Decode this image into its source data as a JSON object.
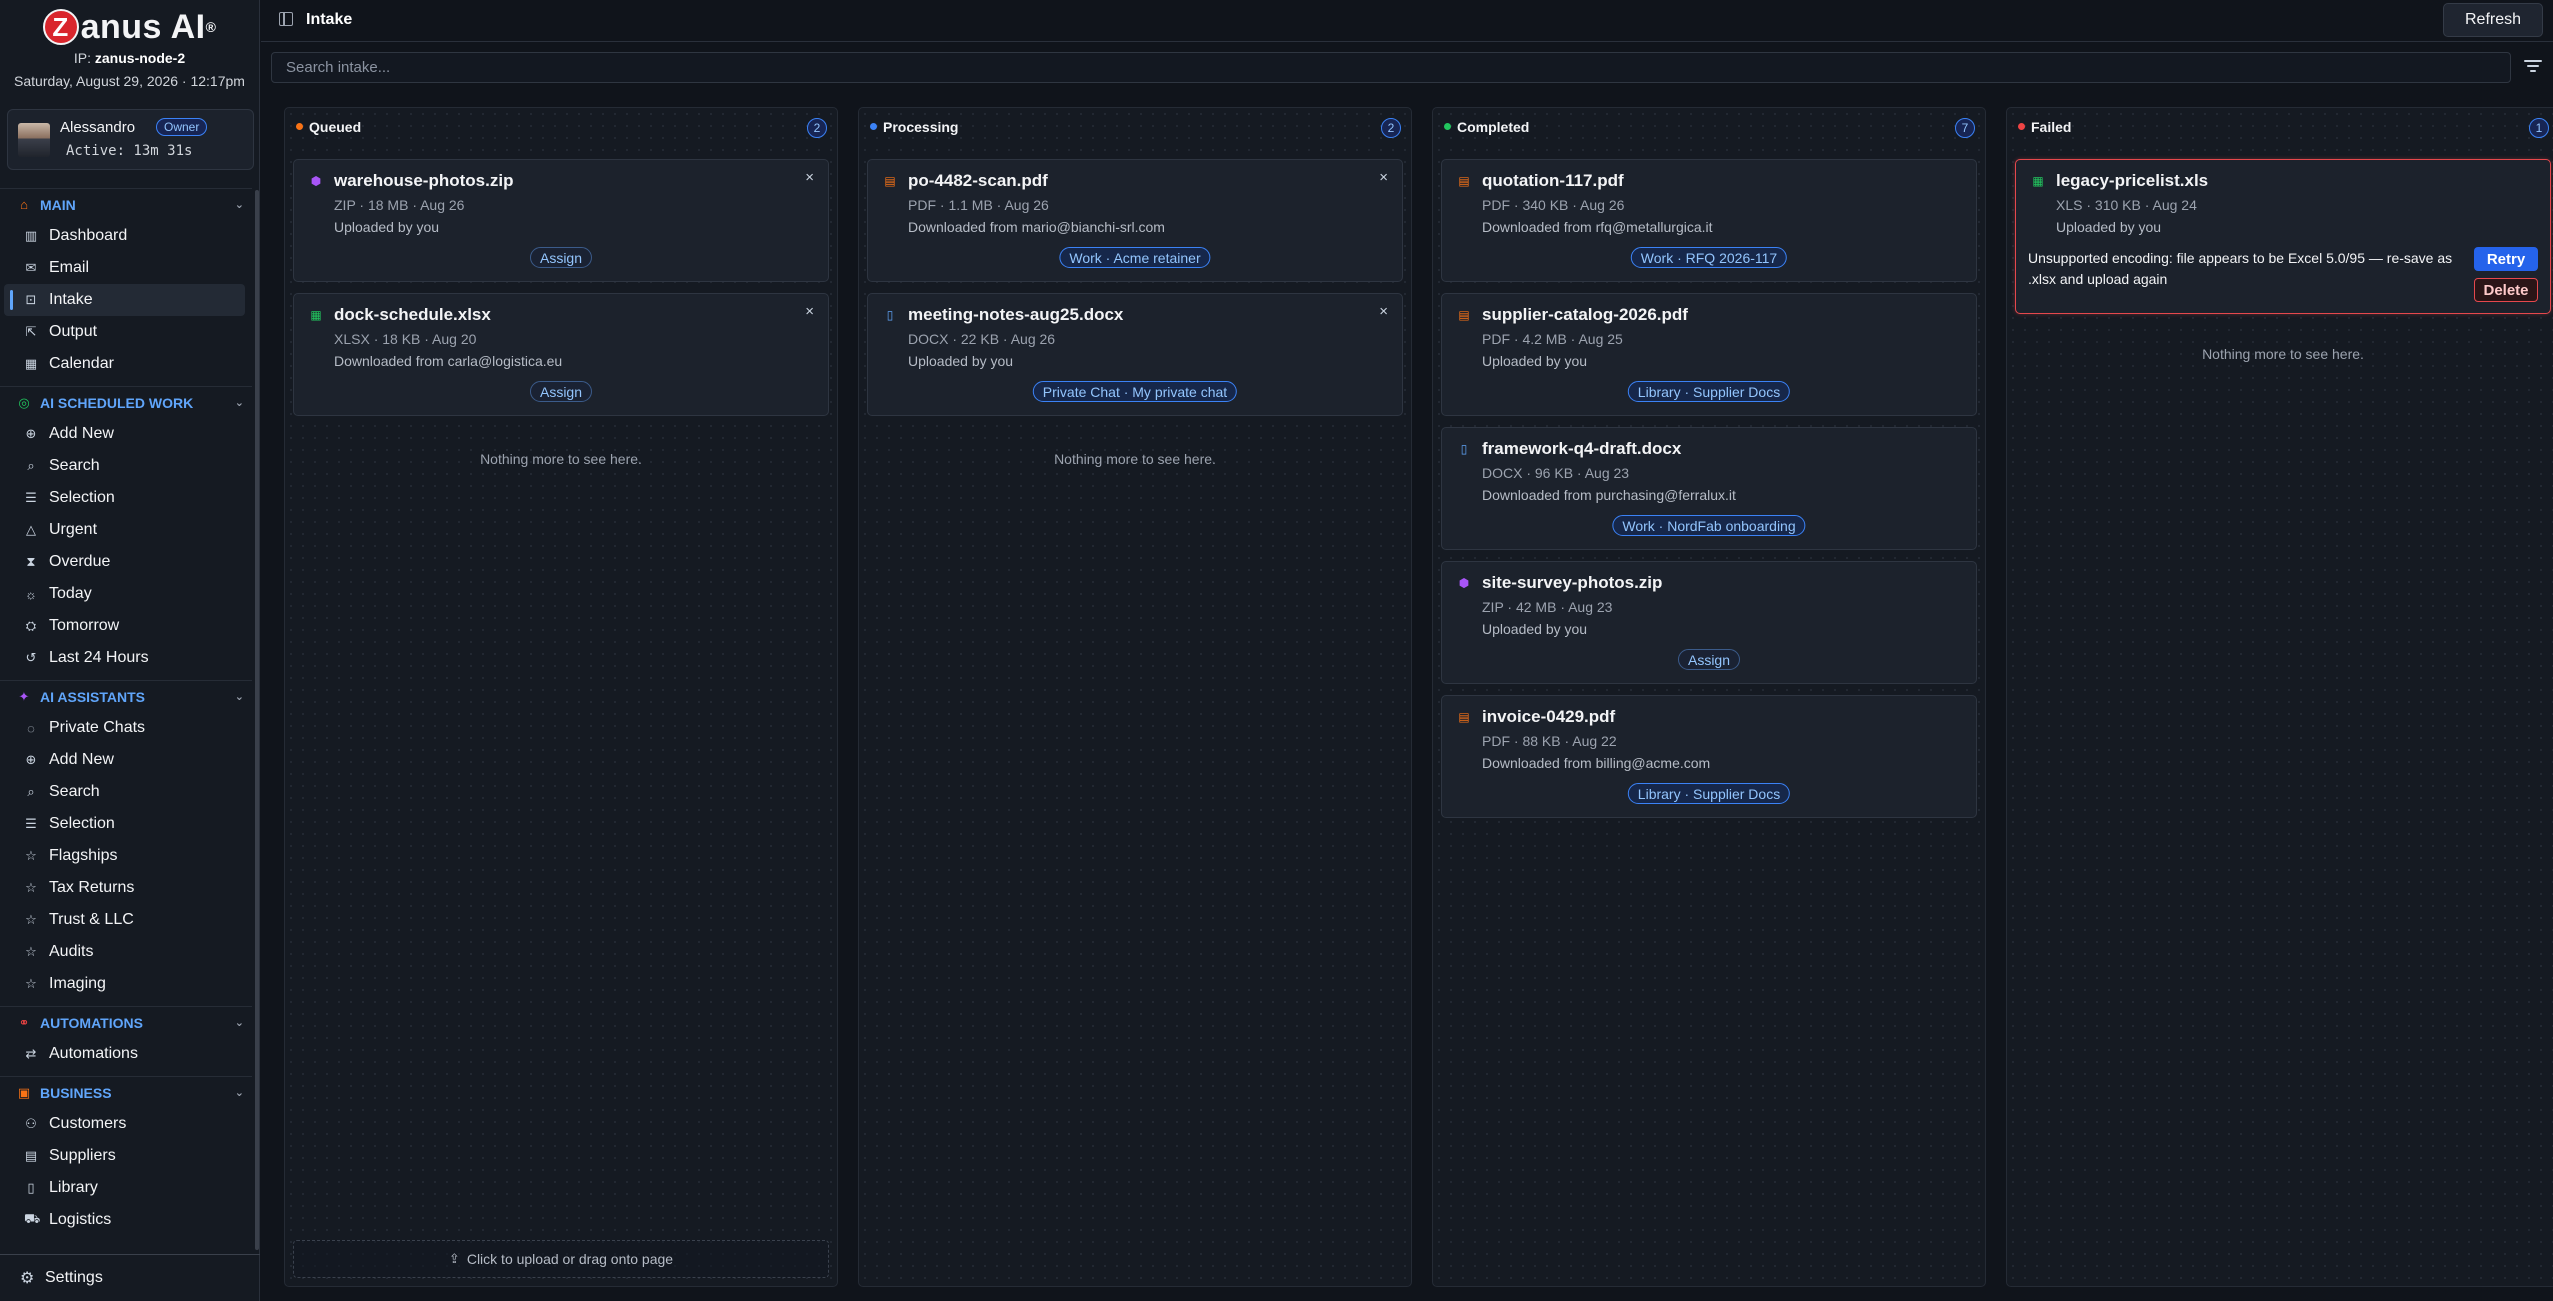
{
  "brand": {
    "name": "Zanus AI",
    "mark": "Z",
    "reg": "®"
  },
  "ip": {
    "label": "IP:",
    "host": "zanus-node-2"
  },
  "datetime": "Saturday, August 29, 2026 · 12:17pm",
  "user": {
    "name": "Alessandro",
    "role": "Owner",
    "active": "Active: 13m 31s"
  },
  "sidebar": {
    "sections": [
      {
        "title": "MAIN",
        "icon": "home-icon",
        "glyph": "⌂",
        "color": "#f97316",
        "items": [
          {
            "label": "Dashboard",
            "icon": "bar-chart-icon",
            "glyph": "▥"
          },
          {
            "label": "Email",
            "icon": "mail-icon",
            "glyph": "✉"
          },
          {
            "label": "Intake",
            "icon": "inbox-icon",
            "glyph": "⊡",
            "active": true
          },
          {
            "label": "Output",
            "icon": "output-icon",
            "glyph": "⇱"
          },
          {
            "label": "Calendar",
            "icon": "calendar-icon",
            "glyph": "▦"
          }
        ]
      },
      {
        "title": "AI SCHEDULED WORK",
        "icon": "ai-work-icon",
        "glyph": "◎",
        "color": "#22c55e",
        "items": [
          {
            "label": "Add New",
            "icon": "plus-circle-icon",
            "glyph": "⊕"
          },
          {
            "label": "Search",
            "icon": "search-icon",
            "glyph": "⌕"
          },
          {
            "label": "Selection",
            "icon": "selection-icon",
            "glyph": "☰"
          },
          {
            "label": "Urgent",
            "icon": "warning-icon",
            "glyph": "△"
          },
          {
            "label": "Overdue",
            "icon": "hourglass-icon",
            "glyph": "⧗"
          },
          {
            "label": "Today",
            "icon": "sun-icon",
            "glyph": "☼"
          },
          {
            "label": "Tomorrow",
            "icon": "sunrise-icon",
            "glyph": "⛭"
          },
          {
            "label": "Last 24 Hours",
            "icon": "history-icon",
            "glyph": "↺"
          }
        ]
      },
      {
        "title": "AI ASSISTANTS",
        "icon": "sparkle-icon",
        "glyph": "✦",
        "color": "#a855f7",
        "items": [
          {
            "label": "Private Chats",
            "icon": "chat-icon",
            "glyph": "◌"
          },
          {
            "label": "Add New",
            "icon": "plus-circle-icon",
            "glyph": "⊕"
          },
          {
            "label": "Search",
            "icon": "search-icon",
            "glyph": "⌕"
          },
          {
            "label": "Selection",
            "icon": "selection-icon",
            "glyph": "☰"
          },
          {
            "label": "Flagships",
            "icon": "star-icon",
            "glyph": "☆"
          },
          {
            "label": "Tax Returns",
            "icon": "star-icon",
            "glyph": "☆"
          },
          {
            "label": "Trust & LLC",
            "icon": "star-icon",
            "glyph": "☆"
          },
          {
            "label": "Audits",
            "icon": "star-icon",
            "glyph": "☆"
          },
          {
            "label": "Imaging",
            "icon": "star-icon",
            "glyph": "☆"
          }
        ]
      },
      {
        "title": "AUTOMATIONS",
        "icon": "workflow-icon",
        "glyph": "⚭",
        "color": "#ef4444",
        "items": [
          {
            "label": "Automations",
            "icon": "automation-icon",
            "glyph": "⇄"
          }
        ]
      },
      {
        "title": "BUSINESS",
        "icon": "briefcase-icon",
        "glyph": "▣",
        "color": "#f97316",
        "items": [
          {
            "label": "Customers",
            "icon": "users-icon",
            "glyph": "⚇"
          },
          {
            "label": "Suppliers",
            "icon": "building-icon",
            "glyph": "▤"
          },
          {
            "label": "Library",
            "icon": "book-icon",
            "glyph": "▯"
          },
          {
            "label": "Logistics",
            "icon": "truck-icon",
            "glyph": "⛟"
          }
        ]
      }
    ],
    "settings": "Settings"
  },
  "header": {
    "title": "Intake",
    "refresh": "Refresh"
  },
  "search": {
    "placeholder": "Search intake..."
  },
  "columns": [
    {
      "key": "queued",
      "title": "Queued",
      "count": "2",
      "dot": "#f97316",
      "cards": [
        {
          "name": "warehouse-photos.zip",
          "type": "zip",
          "meta": "ZIP · 18 MB · Aug 26",
          "source": "Uploaded by you",
          "tag": "Assign",
          "assign": true,
          "closable": true
        },
        {
          "name": "dock-schedule.xlsx",
          "type": "xls",
          "meta": "XLSX · 18 KB · Aug 20",
          "source": "Downloaded from carla@logistica.eu",
          "tag": "Assign",
          "assign": true,
          "closable": true
        }
      ],
      "empty": "Nothing more to see here.",
      "upload": "Click to upload or drag onto page"
    },
    {
      "key": "processing",
      "title": "Processing",
      "count": "2",
      "dot": "#3b82f6",
      "cards": [
        {
          "name": "po-4482-scan.pdf",
          "type": "pdf",
          "meta": "PDF · 1.1 MB · Aug 26",
          "source": "Downloaded from mario@bianchi-srl.com",
          "tag": "Work · Acme retainer",
          "closable": true
        },
        {
          "name": "meeting-notes-aug25.docx",
          "type": "doc",
          "meta": "DOCX · 22 KB · Aug 26",
          "source": "Uploaded by you",
          "tag": "Private Chat · My private chat",
          "closable": true
        }
      ],
      "empty": "Nothing more to see here."
    },
    {
      "key": "completed",
      "title": "Completed",
      "count": "7",
      "dot": "#22c55e",
      "cards": [
        {
          "name": "quotation-117.pdf",
          "type": "pdf",
          "meta": "PDF · 340 KB · Aug 26",
          "source": "Downloaded from rfq@metallurgica.it",
          "tag": "Work · RFQ 2026-117"
        },
        {
          "name": "supplier-catalog-2026.pdf",
          "type": "pdf",
          "meta": "PDF · 4.2 MB · Aug 25",
          "source": "Uploaded by you",
          "tag": "Library · Supplier Docs"
        },
        {
          "name": "framework-q4-draft.docx",
          "type": "doc",
          "meta": "DOCX · 96 KB · Aug 23",
          "source": "Downloaded from purchasing@ferralux.it",
          "tag": "Work · NordFab onboarding"
        },
        {
          "name": "site-survey-photos.zip",
          "type": "zip",
          "meta": "ZIP · 42 MB · Aug 23",
          "source": "Uploaded by you",
          "tag": "Assign",
          "assign": true
        },
        {
          "name": "invoice-0429.pdf",
          "type": "pdf",
          "meta": "PDF · 88 KB · Aug 22",
          "source": "Downloaded from billing@acme.com",
          "tag": "Library · Supplier Docs"
        }
      ]
    },
    {
      "key": "failed",
      "title": "Failed",
      "count": "1",
      "dot": "#ef4444",
      "cards": [
        {
          "name": "legacy-pricelist.xls",
          "type": "xls",
          "meta": "XLS · 310 KB · Aug 24",
          "source": "Uploaded by you",
          "failed": true,
          "error": "Unsupported encoding: file appears to be Excel 5.0/95 — re-save as .xlsx and upload again",
          "retry": "Retry",
          "delete": "Delete"
        }
      ],
      "empty": "Nothing more to see here."
    }
  ],
  "file_icons": {
    "zip": {
      "icon": "archive-icon",
      "glyph": "⬢",
      "color": "#a855f7"
    },
    "xls": {
      "icon": "spreadsheet-icon",
      "glyph": "▦",
      "color": "#22c55e"
    },
    "pdf": {
      "icon": "pdf-file-icon",
      "glyph": "▤",
      "color": "#f97316"
    },
    "doc": {
      "icon": "document-icon",
      "glyph": "▯",
      "color": "#60a5fa"
    }
  },
  "close_glyph": "×"
}
